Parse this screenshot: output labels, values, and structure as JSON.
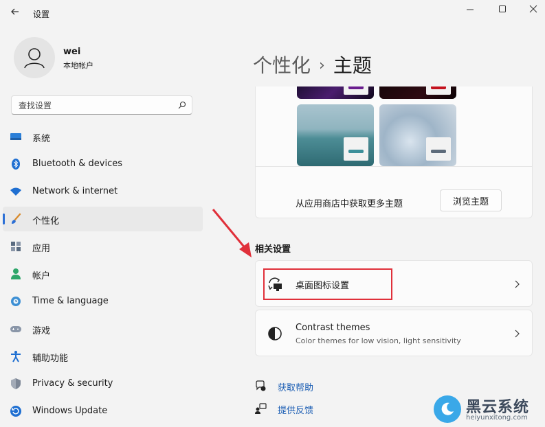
{
  "window": {
    "title": "设置"
  },
  "profile": {
    "name": "wei",
    "account_type": "本地帐户"
  },
  "search": {
    "placeholder": "查找设置"
  },
  "sidebar": {
    "items": [
      {
        "label": "系统",
        "icon": "monitor-icon"
      },
      {
        "label": "Bluetooth & devices",
        "icon": "bluetooth-icon"
      },
      {
        "label": "Network & internet",
        "icon": "wifi-icon"
      },
      {
        "label": "个性化",
        "icon": "brush-icon",
        "selected": true
      },
      {
        "label": "应用",
        "icon": "apps-icon"
      },
      {
        "label": "帐户",
        "icon": "person-icon"
      },
      {
        "label": "Time & language",
        "icon": "globe-clock-icon"
      },
      {
        "label": "游戏",
        "icon": "gamepad-icon"
      },
      {
        "label": "辅助功能",
        "icon": "accessibility-icon"
      },
      {
        "label": "Privacy & security",
        "icon": "shield-icon"
      },
      {
        "label": "Windows Update",
        "icon": "update-icon"
      }
    ]
  },
  "breadcrumb": {
    "parent": "个性化",
    "separator": "›",
    "current": "主题"
  },
  "themes": {
    "store_text": "从应用商店中获取更多主题",
    "browse_button": "浏览主题"
  },
  "related": {
    "title": "相关设置",
    "desktop_icons": {
      "title": "桌面图标设置"
    },
    "contrast": {
      "title": "Contrast themes",
      "subtitle": "Color themes for low vision, light sensitivity"
    }
  },
  "links": {
    "help": "获取帮助",
    "feedback": "提供反馈"
  },
  "watermark": {
    "brand": "黑云系统",
    "url": "heiyunxitong.com"
  },
  "colors": {
    "accent": "#2b6fd6",
    "link": "#1d5fb4",
    "highlight": "#e0303a"
  }
}
